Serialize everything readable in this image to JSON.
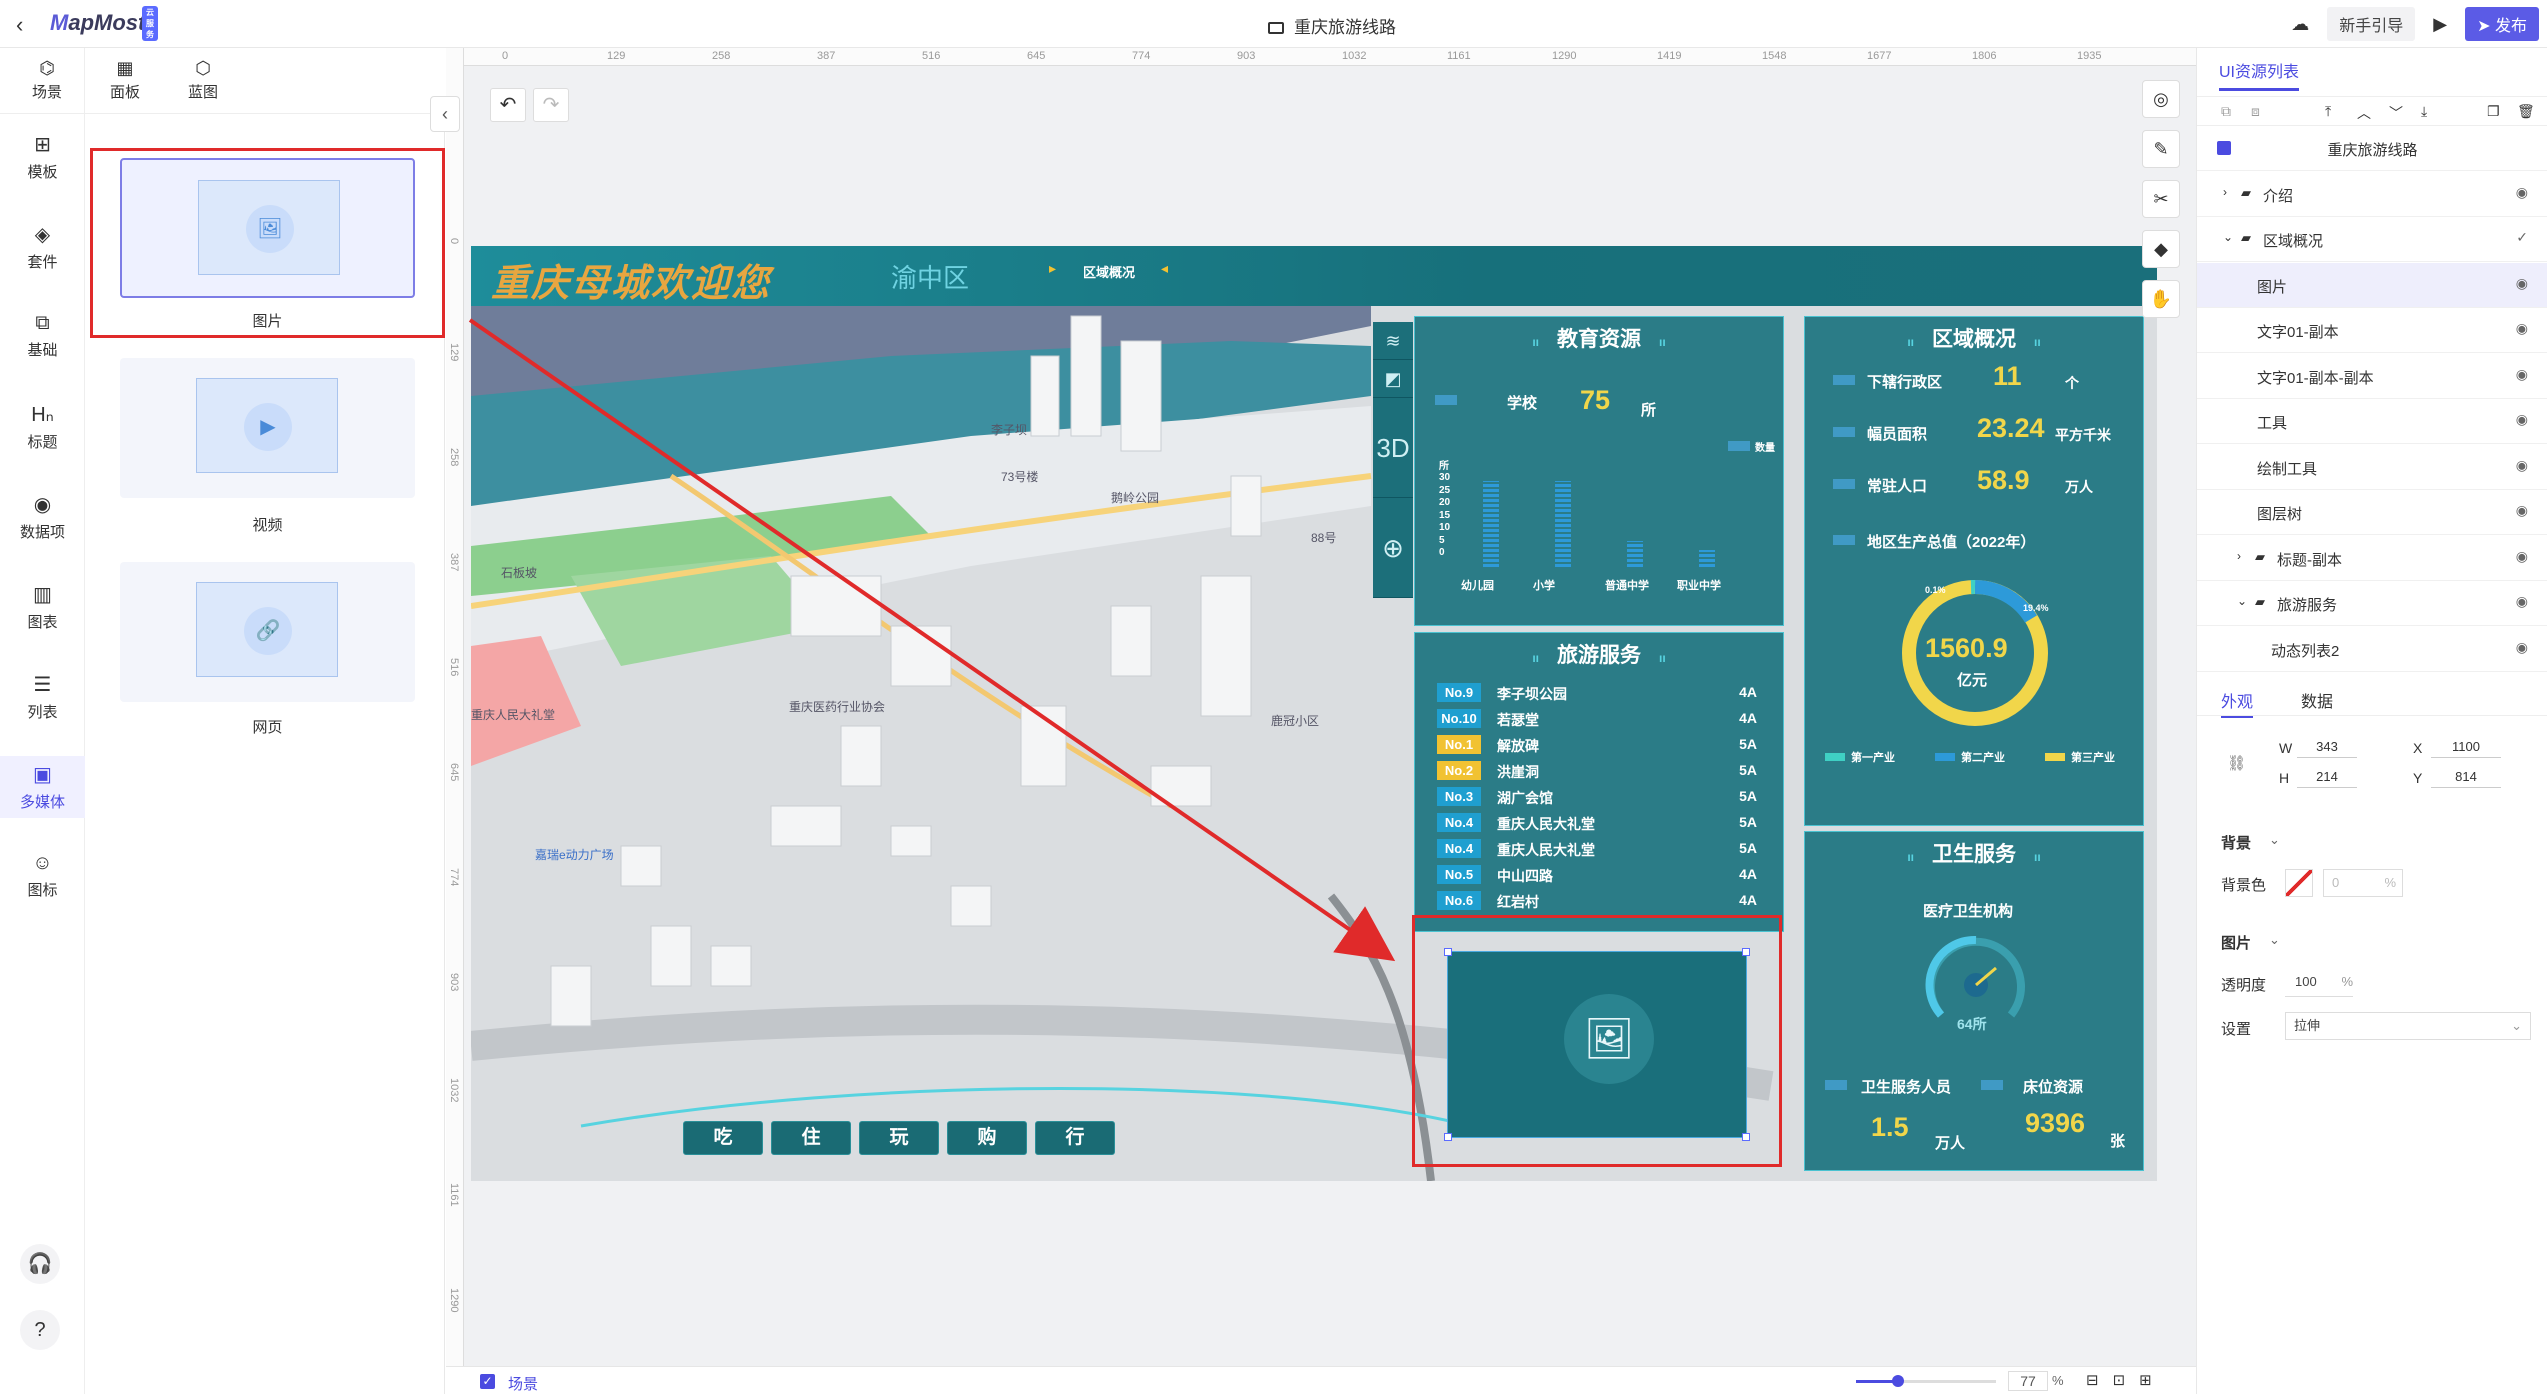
{
  "topbar": {
    "logo_letter": "M",
    "logo_rest": "apMost",
    "logo_badge": "云服务",
    "doc_title": "重庆旅游线路",
    "guide_label": "新手引导",
    "publish_label": "发布"
  },
  "left_tabs": [
    {
      "label": "场景",
      "icon": "globe-icon"
    },
    {
      "label": "面板",
      "icon": "panel-icon"
    },
    {
      "label": "蓝图",
      "icon": "blueprint-icon"
    }
  ],
  "rail": [
    {
      "label": "模板",
      "icon": "template-icon"
    },
    {
      "label": "套件",
      "icon": "kit-icon"
    },
    {
      "label": "基础",
      "icon": "shapes-icon"
    },
    {
      "label": "标题",
      "icon": "heading-icon"
    },
    {
      "label": "数据项",
      "icon": "data-icon"
    },
    {
      "label": "图表",
      "icon": "chart-icon"
    },
    {
      "label": "列表",
      "icon": "list-icon"
    },
    {
      "label": "多媒体",
      "icon": "media-icon"
    },
    {
      "label": "图标",
      "icon": "emoji-icon"
    }
  ],
  "rail_help": "?",
  "components": [
    {
      "label": "图片",
      "icon": "image-icon"
    },
    {
      "label": "视频",
      "icon": "video-icon"
    },
    {
      "label": "网页",
      "icon": "link-icon"
    }
  ],
  "ruler_h": [
    "0",
    "129",
    "258",
    "387",
    "516",
    "645",
    "774",
    "903",
    "1032",
    "1161",
    "1290",
    "1419",
    "1548",
    "1677",
    "1806",
    "1935"
  ],
  "ruler_v": [
    "0",
    "129",
    "258",
    "387",
    "516",
    "645",
    "774",
    "903",
    "1032",
    "1161",
    "1290"
  ],
  "dashboard": {
    "title": "重庆母城欢迎您",
    "district": "渝中区",
    "region_tab": "区域概况",
    "view_3d": "3D",
    "edu": {
      "title": "教育资源",
      "school_label": "学校",
      "school_value": "75",
      "school_unit": "所",
      "y_unit": "所",
      "legend": "数量",
      "y_ticks": [
        "30",
        "25",
        "20",
        "15",
        "10",
        "5",
        "0"
      ],
      "bars": [
        {
          "label": "幼儿园",
          "value": 30
        },
        {
          "label": "小学",
          "value": 30
        },
        {
          "label": "普通中学",
          "value": 9
        },
        {
          "label": "职业中学",
          "value": 6
        }
      ]
    },
    "overview": {
      "title": "区域概况",
      "rows": [
        {
          "label": "下辖行政区",
          "value": "11",
          "unit": "个"
        },
        {
          "label": "幅员面积",
          "value": "23.24",
          "unit": "平方千米"
        },
        {
          "label": "常驻人口",
          "value": "58.9",
          "unit": "万人"
        }
      ],
      "gdp_label": "地区生产总值（2022年）",
      "gdp_value": "1560.9",
      "gdp_unit": "亿元",
      "ring_labels": [
        "0.1%",
        "19.4%"
      ],
      "legend": [
        "第一产业",
        "第二产业",
        "第三产业"
      ]
    },
    "tourism": {
      "title": "旅游服务",
      "items": [
        {
          "no": "No.9",
          "name": "李子坝公园",
          "level": "4A",
          "hot": false
        },
        {
          "no": "No.10",
          "name": "若瑟堂",
          "level": "4A",
          "hot": false
        },
        {
          "no": "No.1",
          "name": "解放碑",
          "level": "5A",
          "hot": true
        },
        {
          "no": "No.2",
          "name": "洪崖洞",
          "level": "5A",
          "hot": true
        },
        {
          "no": "No.3",
          "name": "湖广会馆",
          "level": "5A",
          "hot": false
        },
        {
          "no": "No.4",
          "name": "重庆人民大礼堂",
          "level": "5A",
          "hot": false
        },
        {
          "no": "No.4",
          "name": "重庆人民大礼堂",
          "level": "5A",
          "hot": false
        },
        {
          "no": "No.5",
          "name": "中山四路",
          "level": "4A",
          "hot": false
        },
        {
          "no": "No.6",
          "name": "红岩村",
          "level": "4A",
          "hot": false
        }
      ]
    },
    "health": {
      "title": "卫生服务",
      "inst_label": "医疗卫生机构",
      "inst_value": "64所",
      "staff_label": "卫生服务人员",
      "staff_value": "1.5",
      "staff_unit": "万人",
      "bed_label": "床位资源",
      "bed_value": "9396",
      "bed_unit": "张"
    },
    "nav": [
      "吃",
      "住",
      "玩",
      "购",
      "行"
    ],
    "map_labels": [
      "李子坝",
      "73号楼",
      "鹅岭公园",
      "88号",
      "重庆医药行业协会",
      "鹿冠小区",
      "嘉瑞e动力广场",
      "石板坡",
      "重庆人民大礼堂"
    ]
  },
  "bottombar": {
    "scene_label": "场景",
    "zoom": "77",
    "zoom_unit": "%",
    "zoom_fraction": 0.3
  },
  "right_panel": {
    "title": "UI资源列表",
    "tree": [
      {
        "label": "重庆旅游线路",
        "level": 0,
        "type": "root"
      },
      {
        "label": "介绍",
        "level": 1,
        "type": "folder-collapsed"
      },
      {
        "label": "区域概况",
        "level": 1,
        "type": "folder-open"
      },
      {
        "label": "图片",
        "level": 2,
        "type": "item",
        "selected": true
      },
      {
        "label": "文字01-副本",
        "level": 2,
        "type": "item"
      },
      {
        "label": "文字01-副本-副本",
        "level": 2,
        "type": "item"
      },
      {
        "label": "工具",
        "level": 2,
        "type": "item"
      },
      {
        "label": "绘制工具",
        "level": 2,
        "type": "item"
      },
      {
        "label": "图层树",
        "level": 2,
        "type": "item"
      },
      {
        "label": "标题-副本",
        "level": 2,
        "type": "folder-collapsed"
      },
      {
        "label": "旅游服务",
        "level": 2,
        "type": "folder-open"
      },
      {
        "label": "动态列表2",
        "level": 3,
        "type": "item"
      }
    ],
    "tabs": [
      "外观",
      "数据"
    ],
    "w_label": "W",
    "w_value": "343",
    "h_label": "H",
    "h_value": "214",
    "x_label": "X",
    "x_value": "1100",
    "y_label": "Y",
    "y_value": "814",
    "bg_section": "背景",
    "bg_color_label": "背景色",
    "bg_opacity": "0",
    "bg_opacity_unit": "%",
    "img_section": "图片",
    "opacity_label": "透明度",
    "opacity_value": "100",
    "opacity_unit": "%",
    "setting_label": "设置",
    "setting_value": "拉伸"
  },
  "colors": {
    "accent": "#4b4be0",
    "highlight": "#e02a2a",
    "panel": "#126e7a",
    "gold": "#f1d64a"
  }
}
